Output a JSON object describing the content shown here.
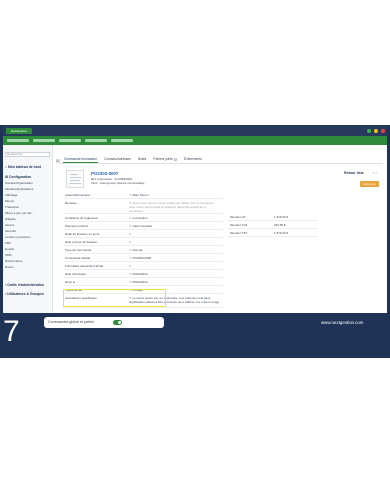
{
  "app": {
    "logo_text": "NextGestion"
  },
  "sidebar": {
    "search_placeholder": "Rechercher",
    "dashboard": "Mon tableau de bord",
    "config_heading": "Configuration",
    "items": [
      "Société/Organisation",
      "Modules/Applications",
      "Affichage",
      "Menus",
      "Traduction",
      "Mises à jour par déf...",
      "Widgets",
      "Alertes",
      "Sécurité",
      "Limites et précision",
      "PDF",
      "Emails",
      "SMS",
      "Dictionnaires",
      "Divers"
    ],
    "admin_tools": "Outils d'administration",
    "users_groups": "Utilisateurs & Groupes"
  },
  "tabs": [
    {
      "label": "Commande fournisseur",
      "active": true
    },
    {
      "label": "Contacts/Adresses",
      "active": false
    },
    {
      "label": "Notes",
      "active": false
    },
    {
      "label": "Fichiers joints",
      "badge": "1",
      "active": false
    },
    {
      "label": "Événements",
      "active": false
    }
  ],
  "order": {
    "ref": "PO2303-0007",
    "ref_supplier_line": "Réf. fournisseur :  FOURN0003",
    "third_party_line": "Tiers :  Anonymous (Autres commandes)",
    "back_link": "Retour liste",
    "status": "Approuvé"
  },
  "form": [
    {
      "label": "Auteur/Demandeur",
      "value": "Marc Simon"
    },
    {
      "label": "Remises",
      "value": "Vous n'avez pas de remise relative par défaut chez ce fournisseur. Vous n'avez aucun crédit de réduction disponible auprès de ce fournisseur.",
      "muted": true
    },
    {
      "label": "Conditions de règlement",
      "value": "A réception"
    },
    {
      "label": "Payment method",
      "value": "Carte bancaire"
    },
    {
      "label": "Délai de livraison en jours",
      "value": ""
    },
    {
      "label": "Date prévue de livraison",
      "value": ""
    },
    {
      "label": "Type de commande",
      "value": "Normal"
    },
    {
      "label": "Commande Global",
      "value": "PO2303-0005"
    },
    {
      "label": "Formulaire demande d'achat",
      "value": ""
    },
    {
      "label": "Date d'émission",
      "value": "03/03/2023"
    },
    {
      "label": "Reçu le",
      "value": "05/03/2023"
    },
    {
      "label": "Type d'achat",
      "value": "Critique"
    },
    {
      "label": "Annotations spécifiques",
      "value": "Le lorem ipsum est, en imprimerie, une suite de mots sans signification utilisée à titre provisoire pour calibrer une mise en page"
    }
  ],
  "amounts": [
    {
      "label": "Montant HT",
      "value": "1 316,00 €"
    },
    {
      "label": "Montant TVA",
      "value": "263,60 €"
    },
    {
      "label": "Montant TTC",
      "value": "1 579,20 €"
    }
  ],
  "footer": {
    "step": "7",
    "toggle_label": "Commandes global et partiel",
    "toggle_on": true,
    "site": "www.nextgestion.com"
  },
  "colors": {
    "frame": "#1f3356",
    "accent": "#2e8b3a",
    "highlight": "#f0e239",
    "status": "#e8a33c"
  }
}
